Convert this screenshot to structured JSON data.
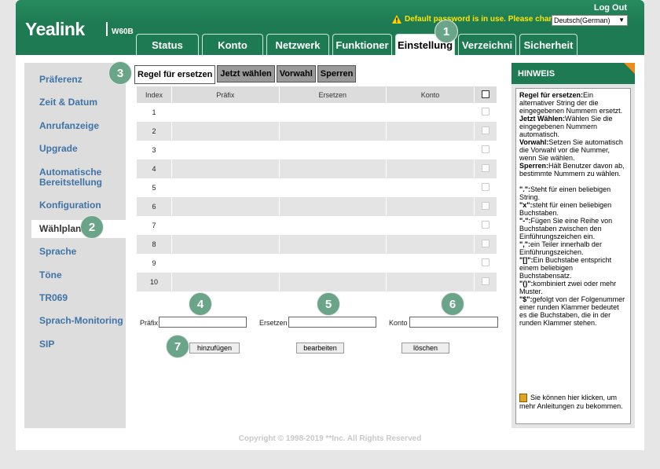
{
  "header": {
    "logo": "Yealink",
    "model": "W60B",
    "logout": "Log Out",
    "warning": "Default password is in use. Please change!",
    "language": "Deutsch(German)",
    "tabs": [
      "Status",
      "Konto",
      "Netzwerk",
      "Funktioner",
      "Einstellung",
      "Verzeichni",
      "Sicherheit"
    ],
    "active_tab": "Einstellung"
  },
  "sidebar": {
    "items": [
      "Präferenz",
      "Zeit & Datum",
      "Anrufanzeige",
      "Upgrade",
      "Automatische Bereitstellung",
      "Konfiguration",
      "Wählplan",
      "Sprache",
      "Töne",
      "TR069",
      "Sprach-Monitoring",
      "SIP"
    ],
    "active": "Wählplan"
  },
  "subtabs": {
    "items": [
      "Regel für ersetzen",
      "Jetzt wählen",
      "Vorwahl",
      "Sperren"
    ],
    "active": "Regel für ersetzen"
  },
  "table": {
    "headers": [
      "Index",
      "Präfix",
      "Ersetzen",
      "Konto"
    ],
    "rows": [
      {
        "index": "1"
      },
      {
        "index": "2"
      },
      {
        "index": "3"
      },
      {
        "index": "4"
      },
      {
        "index": "5"
      },
      {
        "index": "6"
      },
      {
        "index": "7"
      },
      {
        "index": "8"
      },
      {
        "index": "9"
      },
      {
        "index": "10"
      }
    ]
  },
  "form": {
    "prefix_label": "Präfix",
    "replace_label": "Ersetzen",
    "account_label": "Konto",
    "prefix_value": "",
    "replace_value": "",
    "account_value": "",
    "add_button": "hinzufügen",
    "edit_button": "bearbeiten",
    "delete_button": "löschen"
  },
  "badges": [
    "1",
    "2",
    "3",
    "4",
    "5",
    "6",
    "7"
  ],
  "hint": {
    "title": "HINWEIS",
    "paragraphs": [
      {
        "term": "Regel für ersetzen:",
        "text": "Ein alternativer String der die eingegebenen Nummern ersetzt."
      },
      {
        "term": "Jetzt Wählen:",
        "text": "Wählen Sie die eingegebenen Nummern automatisch."
      },
      {
        "term": "Vorwahl:",
        "text": "Setzen Sie automatisch die Vorwahl vor die Nummer, wenn Sie wählen."
      },
      {
        "term": "Sperren:",
        "text": "Hält Benutzer davon ab, bestimmte Nummern zu wählen."
      },
      {
        "term": "\".\":",
        "text": "Steht für einen beliebigen String."
      },
      {
        "term": "\"x\":",
        "text": "steht für einen beliebigen Buchstaben."
      },
      {
        "term": "\"-\":",
        "text": "Fügen Sie eine Reihe von Buchstaben zwischen den Einführungszeichen ein."
      },
      {
        "term": "\",\":",
        "text": "ein Teiler innerhalb der Einführungszeichen."
      },
      {
        "term": "\"[]\":",
        "text": "Ein Buchstabe entspricht einem beliebigen Buchstabensatz."
      },
      {
        "term": "\"()\":",
        "text": "kombiniert zwei oder mehr Muster."
      },
      {
        "term": "\"$\":",
        "text": "gefolgt von der Folgenummer einer runden Klammer bedeutet es die Buchstaben, die in der runden Klammer stehen."
      }
    ],
    "help": "Sie können hier klicken, um mehr Anleitungen zu bekommen."
  },
  "copyright": "Copyright © 1998-2019 **Inc. All Rights Reserved",
  "colors": {
    "brand": "#1e7a52",
    "accent": "#ea8b1a",
    "link": "#3f73a6",
    "badge": "#6aa58a"
  }
}
